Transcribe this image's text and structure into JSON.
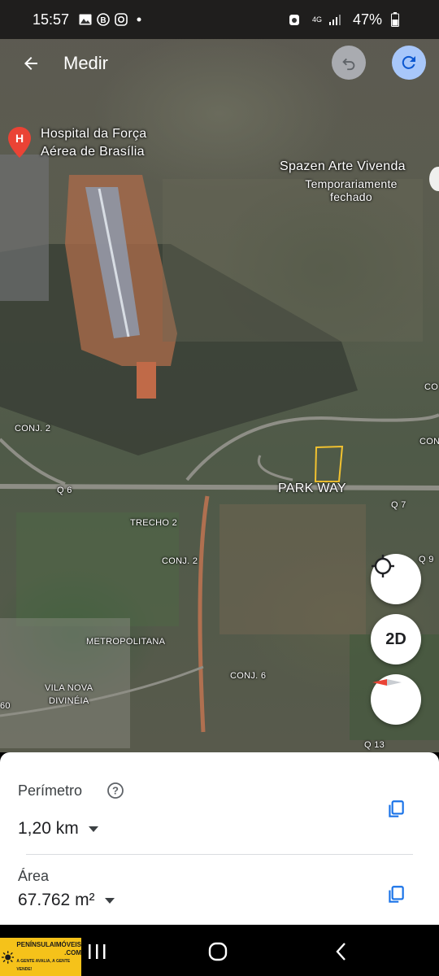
{
  "status_bar": {
    "time": "15:57",
    "battery": "47%",
    "network": "4G"
  },
  "app_bar": {
    "title": "Medir"
  },
  "map": {
    "place_name_line1": "Hospital da Força",
    "place_name_line2": "Aérea de Brasília",
    "poi_name": "Spazen Arte Vivenda",
    "poi_status_line1": "Temporariamente",
    "poi_status_line2": "fechado",
    "labels": {
      "conj2_left": "CONJ. 2",
      "co_right": "CO",
      "con_right": "CON",
      "q6": "Q 6",
      "park_way": "PARK WAY",
      "q7": "Q 7",
      "trecho2": "TRECHO 2",
      "conj2_mid": "CONJ. 2",
      "q9": "Q 9",
      "metropolitana": "METROPOLITANA",
      "conj6": "CONJ. 6",
      "vila_nova_1": "VILA NOVA",
      "vila_nova_2": "DIVINÉIA",
      "sixty": "60",
      "q13": "Q 13"
    },
    "mode_button": "2D"
  },
  "sheet": {
    "perimeter_label": "Perímetro",
    "perimeter_value": "1,20 km",
    "area_label": "Área",
    "area_value": "67.762 m²"
  },
  "ad": {
    "brand_line1": "PENÍNSULAIMÓVEIS",
    "brand_line2": ".COM",
    "slogan": "A GENTE AVALIA, A GENTE VENDE!"
  },
  "colors": {
    "measure_outline": "#f2c230",
    "redo_bg": "#a8c7fa",
    "undo_bg": "#a9abb0",
    "copy_icon": "#1a73e8",
    "pin": "#ea4335"
  }
}
